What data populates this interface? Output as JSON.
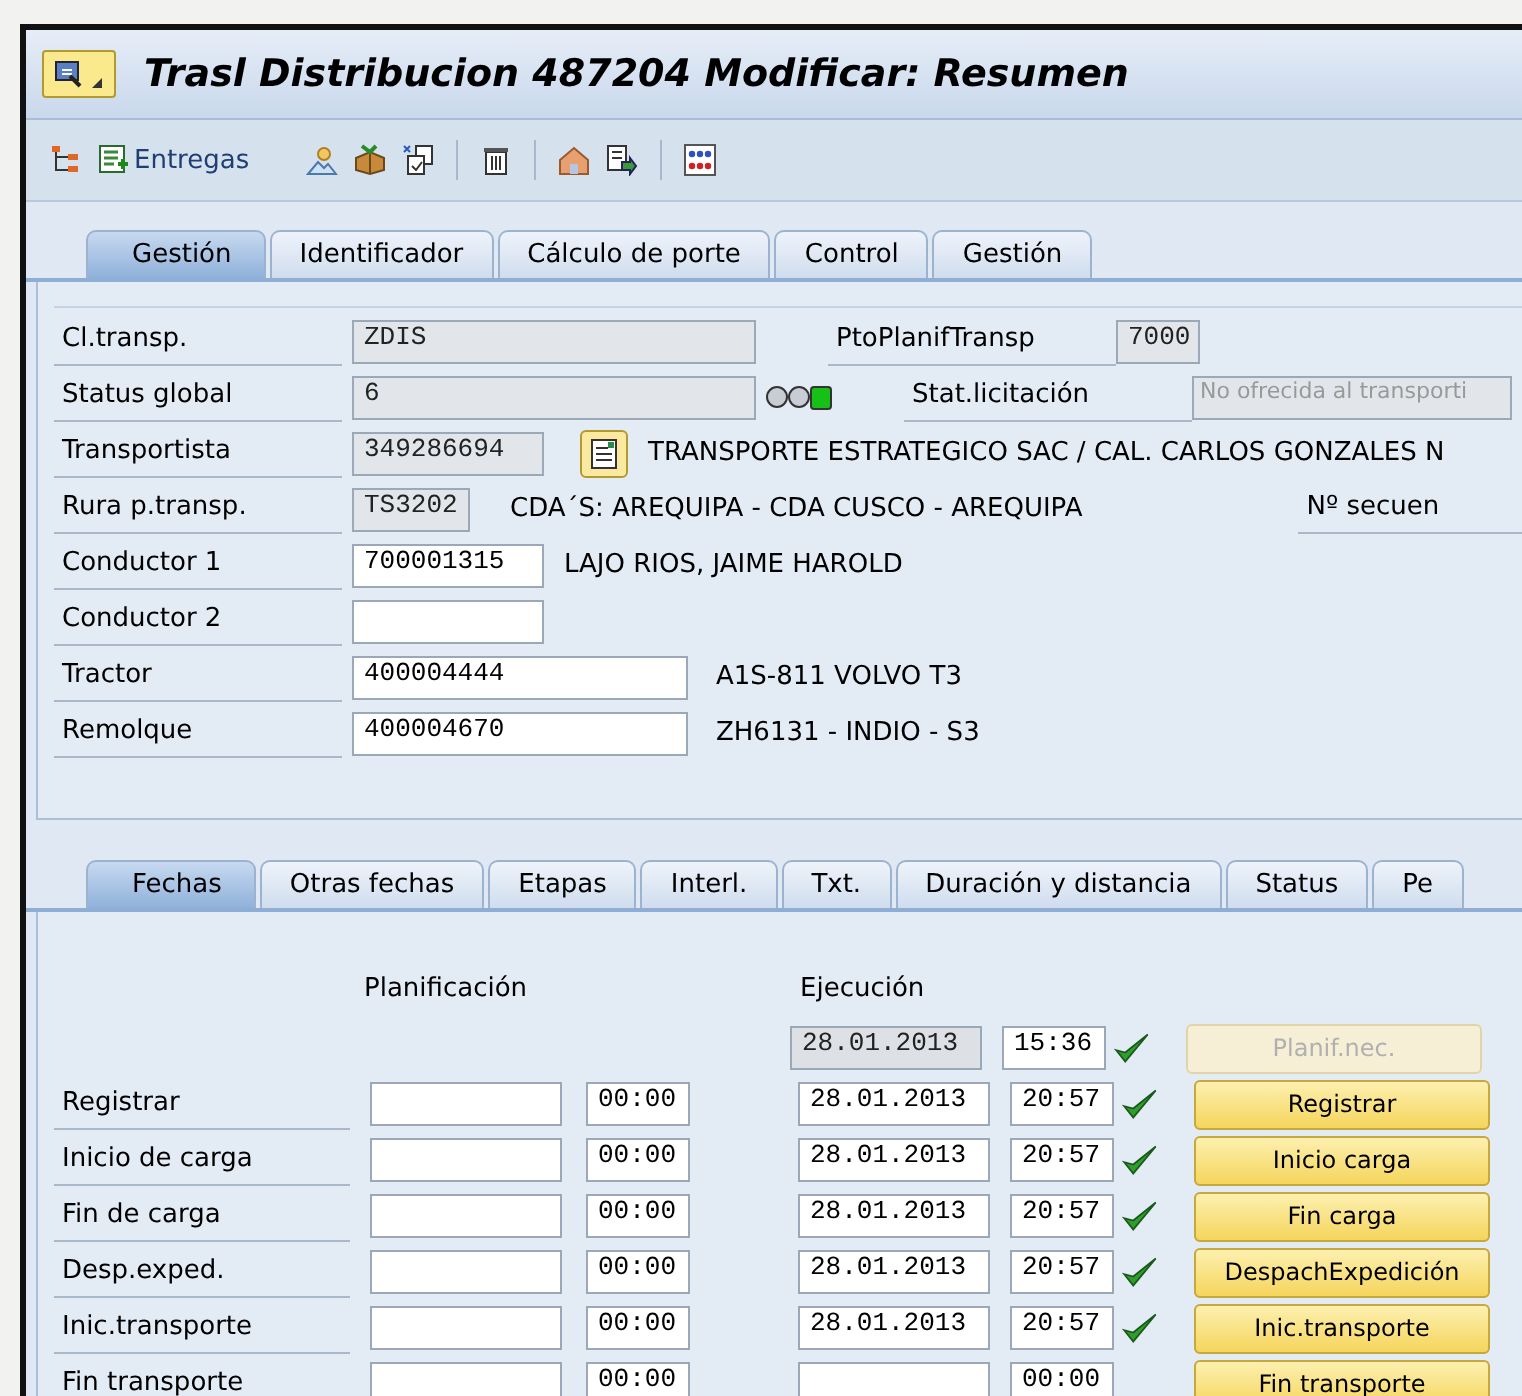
{
  "window": {
    "title": "Trasl Distribucion 487204 Modificar: Resumen"
  },
  "toolbar": {
    "entregas_label": "Entregas"
  },
  "tabs": [
    {
      "label": "Gestión",
      "selected": true
    },
    {
      "label": "Identificador",
      "selected": false
    },
    {
      "label": "Cálculo de porte",
      "selected": false
    },
    {
      "label": "Control",
      "selected": false
    },
    {
      "label": "Gestión",
      "selected": false
    }
  ],
  "header": {
    "rows": [
      {
        "label": "Cl.transp.",
        "field": {
          "kind": "display",
          "value": "ZDIS"
        },
        "side_label": "PtoPlanifTransp",
        "side_field": {
          "kind": "display",
          "value": "7000"
        }
      },
      {
        "label": "Status global",
        "field": {
          "kind": "display",
          "value": "6"
        },
        "status_lights": [
          {
            "lit": false
          },
          {
            "lit": false
          },
          {
            "lit": true
          }
        ],
        "side_label": "Stat.licitación",
        "side_field": {
          "kind": "display",
          "value": "No ofrecida al transporti",
          "disabled": true
        }
      },
      {
        "label": "Transportista",
        "field": {
          "kind": "display",
          "value": "349286694"
        },
        "has_detail_button": true,
        "description": "TRANSPORTE ESTRATEGICO SAC / CAL. CARLOS GONZALES N"
      },
      {
        "label": "Rura p.transp.",
        "field": {
          "kind": "display",
          "value": "TS3202"
        },
        "description": "CDA´S: AREQUIPA - CDA CUSCO - AREQUIPA",
        "side_label": "Nº secuen"
      },
      {
        "label": "Conductor 1",
        "field": {
          "kind": "input",
          "value": "700001315"
        },
        "description": "LAJO RIOS, JAIME HAROLD"
      },
      {
        "label": "Conductor 2",
        "field": {
          "kind": "input"
        }
      },
      {
        "label": "Tractor",
        "field": {
          "kind": "input",
          "value": "400004444"
        },
        "description": "A1S-811 VOLVO T3"
      },
      {
        "label": "Remolque",
        "field": {
          "kind": "input",
          "value": "400004670"
        },
        "description": "ZH6131 - INDIO - S3"
      }
    ]
  },
  "detail_tabs": [
    {
      "label": "Fechas",
      "selected": true
    },
    {
      "label": "Otras fechas",
      "selected": false
    },
    {
      "label": "Etapas",
      "selected": false
    },
    {
      "label": "Interl.",
      "selected": false
    },
    {
      "label": "Txt.",
      "selected": false
    },
    {
      "label": "Duración y distancia",
      "selected": false
    },
    {
      "label": "Status",
      "selected": false
    },
    {
      "label": "Pe",
      "selected": false
    }
  ],
  "dates": {
    "planning_heading": "Planificación",
    "execution_heading": "Ejecución",
    "rows": [
      {
        "exec_date": {
          "kind": "display",
          "value": "28.01.2013"
        },
        "exec_time": "15:36",
        "done": true,
        "button": {
          "label": "Planif.nec.",
          "disabled": true
        }
      },
      {
        "label": "Registrar",
        "plan_time": "00:00",
        "exec_date": {
          "kind": "input",
          "value": "28.01.2013"
        },
        "exec_time": "20:57",
        "done": true,
        "button": {
          "label": "Registrar",
          "disabled": false
        }
      },
      {
        "label": "Inicio de carga",
        "plan_time": "00:00",
        "exec_date": {
          "kind": "input",
          "value": "28.01.2013"
        },
        "exec_time": "20:57",
        "done": true,
        "button": {
          "label": "Inicio carga",
          "disabled": false
        }
      },
      {
        "label": "Fin de carga",
        "plan_time": "00:00",
        "exec_date": {
          "kind": "input",
          "value": "28.01.2013"
        },
        "exec_time": "20:57",
        "done": true,
        "button": {
          "label": "Fin carga",
          "disabled": false
        }
      },
      {
        "label": "Desp.exped.",
        "plan_time": "00:00",
        "exec_date": {
          "kind": "input",
          "value": "28.01.2013"
        },
        "exec_time": "20:57",
        "done": true,
        "button": {
          "label": "DespachExpedición",
          "disabled": false
        }
      },
      {
        "label": "Inic.transporte",
        "plan_time": "00:00",
        "exec_date": {
          "kind": "input",
          "value": "28.01.2013"
        },
        "exec_time": "20:57",
        "done": true,
        "button": {
          "label": "Inic.transporte",
          "disabled": false
        }
      },
      {
        "label": "Fin transporte",
        "plan_time": "00:00",
        "exec_date": {
          "kind": "input"
        },
        "exec_time": "00:00",
        "done": false,
        "button": {
          "label": "Fin transporte",
          "disabled": false
        }
      }
    ]
  }
}
